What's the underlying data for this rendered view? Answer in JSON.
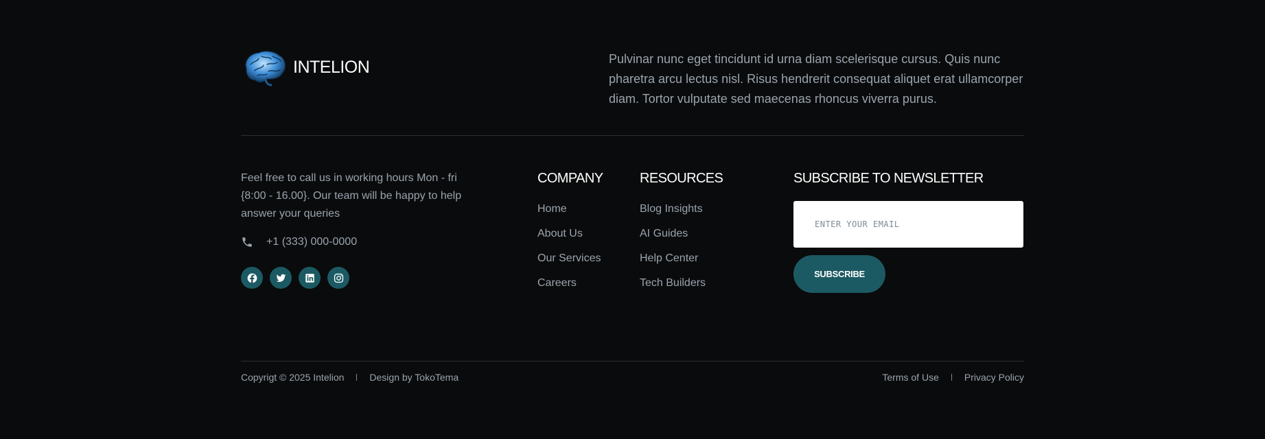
{
  "brand": {
    "name": "INTELION",
    "logo_icon": "brain-icon",
    "accent": "#1c5a63"
  },
  "intro": {
    "text": "Pulvinar nunc eget tincidunt id urna diam scelerisque cursus. Quis nunc pharetra arcu lectus nisl. Risus hendrerit consequat aliquet erat ullamcorper diam. Tortor vulputate sed maecenas rhoncus viverra purus."
  },
  "contact": {
    "text": "Feel free to call us in working hours Mon - fri {8:00 - 16.00}. Our team will be happy to help answer your queries",
    "phone_icon": "phone-icon",
    "phone": "+1 (333) 000-0000",
    "socials": [
      {
        "name": "facebook",
        "icon": "facebook-icon"
      },
      {
        "name": "twitter",
        "icon": "twitter-icon"
      },
      {
        "name": "linkedin",
        "icon": "linkedin-icon"
      },
      {
        "name": "instagram",
        "icon": "instagram-icon"
      }
    ]
  },
  "company": {
    "heading": "COMPANY",
    "links": [
      "Home",
      "About Us",
      "Our Services",
      "Careers"
    ]
  },
  "resources": {
    "heading": "RESOURCES",
    "links": [
      "Blog Insights",
      "AI Guides",
      "Help Center",
      "Tech Builders"
    ]
  },
  "newsletter": {
    "heading": "SUBSCRIBE TO NEWSLETTER",
    "email_placeholder": "ENTER YOUR EMAIL",
    "email_value": "",
    "button_label": "SUBSCRIBE"
  },
  "bottom": {
    "copyright": "Copyrigt © 2025 Intelion",
    "design": "Design by TokoTema",
    "terms": "Terms of Use",
    "privacy": "Privacy Policy"
  },
  "colors": {
    "background": "#0a0b0c",
    "text_muted": "#9aa4ae",
    "heading": "#ffffff",
    "accent": "#1c5a63"
  }
}
